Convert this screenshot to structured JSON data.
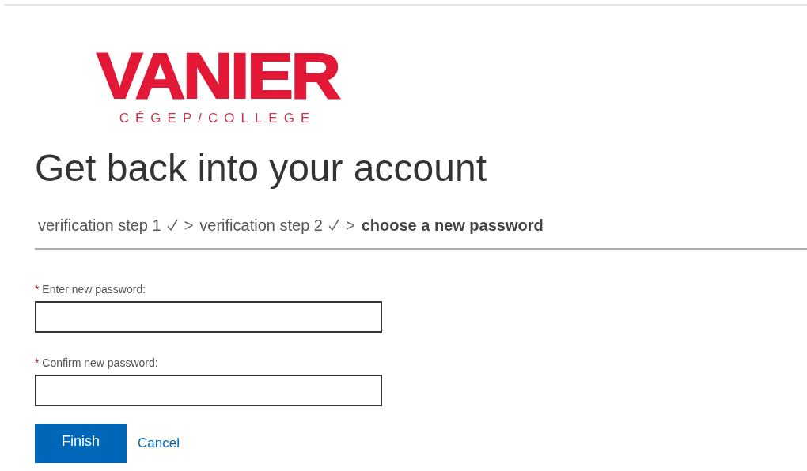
{
  "logo": {
    "name": "VANIER",
    "subtitle": "CÉGEP/COLLEGE"
  },
  "heading": "Get back into your account",
  "steps": [
    {
      "label": "verification step 1",
      "completed": true,
      "selected": false
    },
    {
      "label": "verification step 2",
      "completed": true,
      "selected": false
    },
    {
      "label": "choose a new password",
      "completed": false,
      "selected": true
    }
  ],
  "step_separator": ">",
  "fields": [
    {
      "label": "Enter new password:",
      "required": true
    },
    {
      "label": "Confirm new password:",
      "required": true
    }
  ],
  "required_mark": "*",
  "buttons": [
    {
      "label": "Finish",
      "kind": "primary"
    },
    {
      "label": "Cancel",
      "kind": "link"
    }
  ]
}
